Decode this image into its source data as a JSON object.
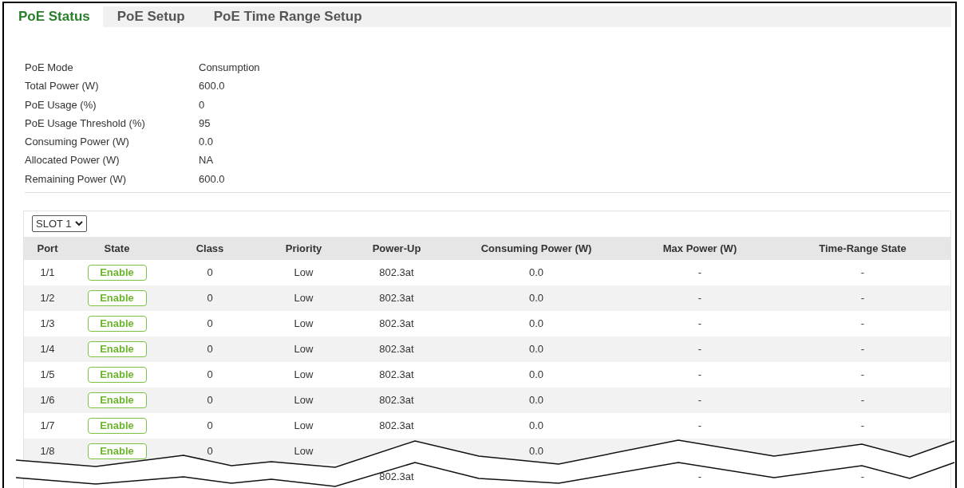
{
  "tabs": [
    {
      "label": "PoE Status",
      "selected": true
    },
    {
      "label": "PoE Setup",
      "selected": false
    },
    {
      "label": "PoE Time Range Setup",
      "selected": false
    }
  ],
  "info": [
    {
      "label": "PoE Mode",
      "value": "Consumption"
    },
    {
      "label": "Total Power (W)",
      "value": "600.0"
    },
    {
      "label": "PoE Usage (%)",
      "value": "0"
    },
    {
      "label": "PoE Usage Threshold (%)",
      "value": "95"
    },
    {
      "label": "Consuming Power (W)",
      "value": "0.0"
    },
    {
      "label": "Allocated Power (W)",
      "value": "NA"
    },
    {
      "label": "Remaining Power (W)",
      "value": "600.0"
    }
  ],
  "slot_select": {
    "value": "SLOT 1"
  },
  "table": {
    "columns": [
      "Port",
      "State",
      "Class",
      "Priority",
      "Power-Up",
      "Consuming Power (W)",
      "Max Power (W)",
      "Time-Range State"
    ],
    "rows": [
      {
        "port": "1/1",
        "state": "Enable",
        "class": "0",
        "priority": "Low",
        "power_up": "802.3at",
        "consuming_power": "0.0",
        "max_power": "-",
        "time_range_state": "-"
      },
      {
        "port": "1/2",
        "state": "Enable",
        "class": "0",
        "priority": "Low",
        "power_up": "802.3at",
        "consuming_power": "0.0",
        "max_power": "-",
        "time_range_state": "-"
      },
      {
        "port": "1/3",
        "state": "Enable",
        "class": "0",
        "priority": "Low",
        "power_up": "802.3at",
        "consuming_power": "0.0",
        "max_power": "-",
        "time_range_state": "-"
      },
      {
        "port": "1/4",
        "state": "Enable",
        "class": "0",
        "priority": "Low",
        "power_up": "802.3at",
        "consuming_power": "0.0",
        "max_power": "-",
        "time_range_state": "-"
      },
      {
        "port": "1/5",
        "state": "Enable",
        "class": "0",
        "priority": "Low",
        "power_up": "802.3at",
        "consuming_power": "0.0",
        "max_power": "-",
        "time_range_state": "-"
      },
      {
        "port": "1/6",
        "state": "Enable",
        "class": "0",
        "priority": "Low",
        "power_up": "802.3at",
        "consuming_power": "0.0",
        "max_power": "-",
        "time_range_state": "-"
      },
      {
        "port": "1/7",
        "state": "Enable",
        "class": "0",
        "priority": "Low",
        "power_up": "802.3at",
        "consuming_power": "0.0",
        "max_power": "-",
        "time_range_state": "-"
      },
      {
        "port": "1/8",
        "state": "Enable",
        "class": "0",
        "priority": "Low",
        "consuming_power": "0.0"
      },
      {
        "power_up": "802.3at",
        "max_power": "-",
        "time_range_state": "-"
      }
    ]
  }
}
